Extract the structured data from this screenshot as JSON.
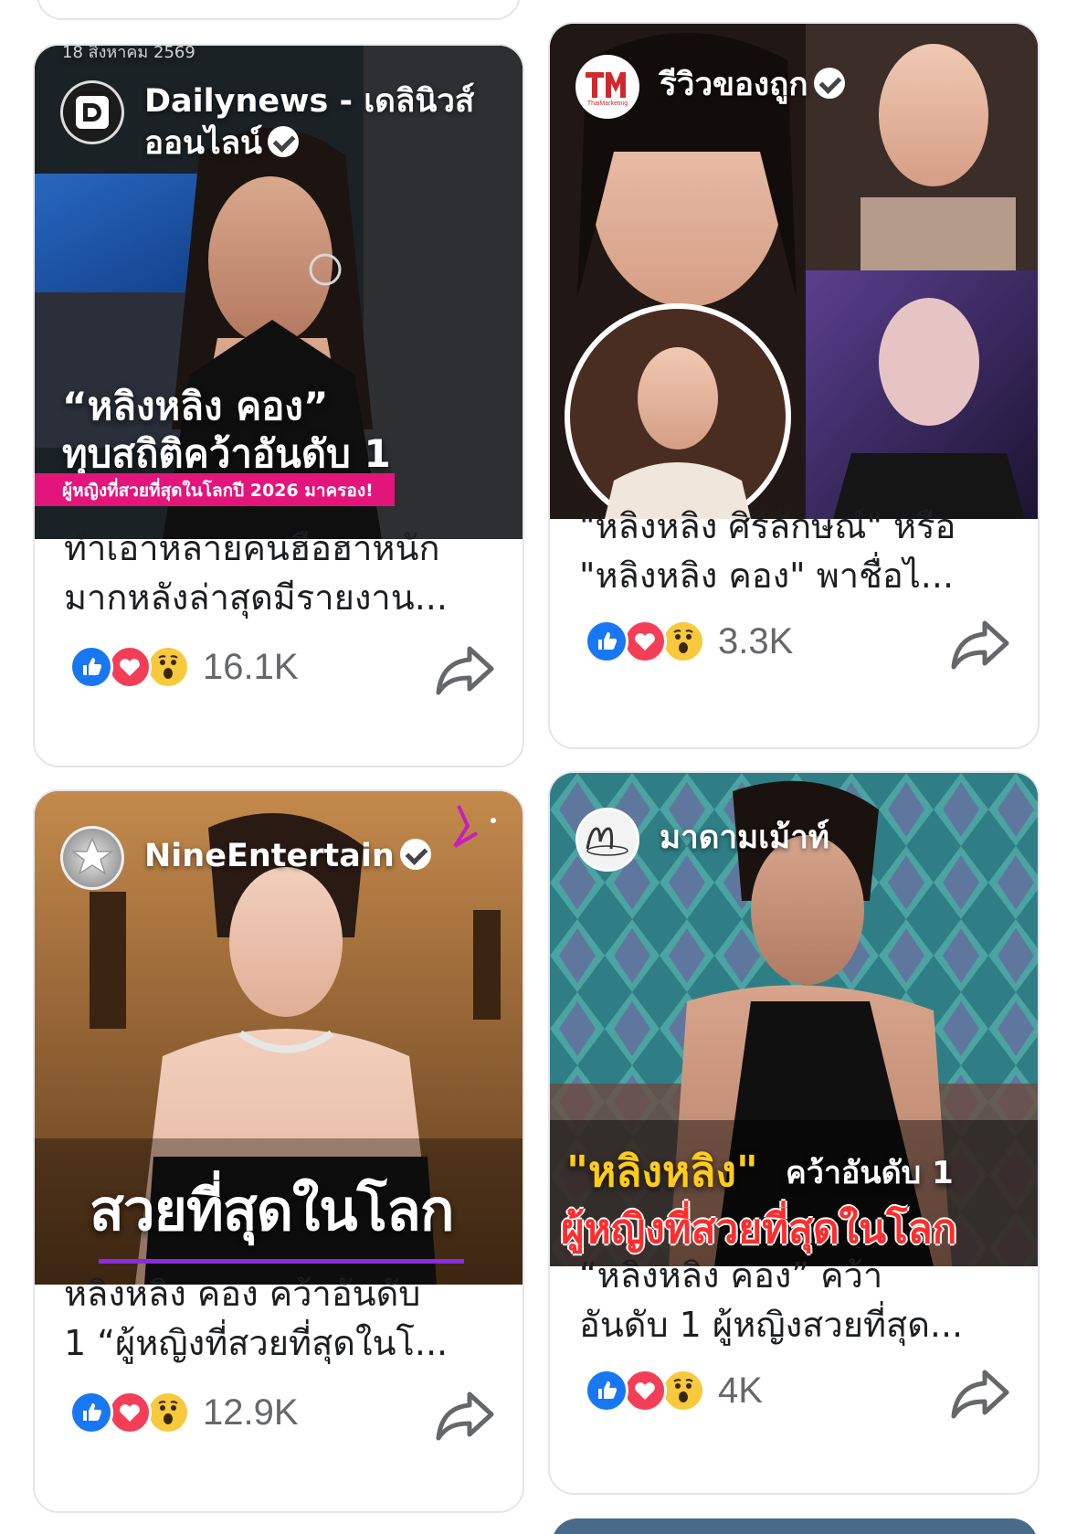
{
  "colors": {
    "like": "#1877f2",
    "love": "#f33e58",
    "wow": "#f7c93c",
    "meta_text": "#65676b",
    "pink_banner": "#e3157b",
    "gold_title": "#ffcc1a",
    "red_title": "#ff2d2d"
  },
  "posts": [
    {
      "page_name_line1": "Dailynews - เดลินิวส์",
      "page_name_line2": "ออนไลน์",
      "verified": true,
      "avatar_icon": "dailynews-logo",
      "image_date": "18 สิงหาคม 2569",
      "image_title_1": "“หลิงหลิง คอง”",
      "image_title_2": "ทุบสถิติคว้าอันดับ 1",
      "image_banner": "ผู้หญิงที่สวยที่สุดในโลกปี 2026 มาครอง!",
      "caption_1": "ทำเอาหลายคนฮือฮาหนัก",
      "caption_2": "มากหลังล่าสุดมีรายงาน...",
      "reactions": [
        "like",
        "love",
        "wow"
      ],
      "reaction_count": "16.1K"
    },
    {
      "page_name_line1": "รีวิวของถูก",
      "verified": true,
      "avatar_icon": "thaimarketing-logo",
      "avatar_text": "ThaiMarketing",
      "caption_1": "\"หลิงหลิง ศิริลักษณ์\" หรือ",
      "caption_2": "\"หลิงหลิง คอง\" พาชื่อไ...",
      "reactions": [
        "like",
        "love",
        "wow"
      ],
      "reaction_count": "3.3K"
    },
    {
      "page_name_line1": "NineEntertain",
      "verified": true,
      "avatar_icon": "nine-entertain-logo",
      "image_title_1": "สวยที่สุดในโลก",
      "caption_1": "หลิงหลิง คอง  คว้าอันดับ",
      "caption_2": "1 “ผู้หญิงที่สวยที่สุดในโ...",
      "reactions": [
        "like",
        "love",
        "wow"
      ],
      "reaction_count": "12.9K"
    },
    {
      "page_name_line1": "มาดามเม้าท์",
      "verified": false,
      "avatar_icon": "madam-mouth-logo",
      "image_title_1a": "\"หลิงหลิง\"",
      "image_title_1b": "คว้าอันดับ 1",
      "image_title_2": "ผู้หญิงที่สวยที่สุดในโลก",
      "caption_1": "“หลิงหลิง คอง” คว้า",
      "caption_2": "อันดับ 1 ผู้หญิงสวยที่สุด...",
      "reactions": [
        "like",
        "love",
        "wow"
      ],
      "reaction_count": "4K"
    }
  ]
}
